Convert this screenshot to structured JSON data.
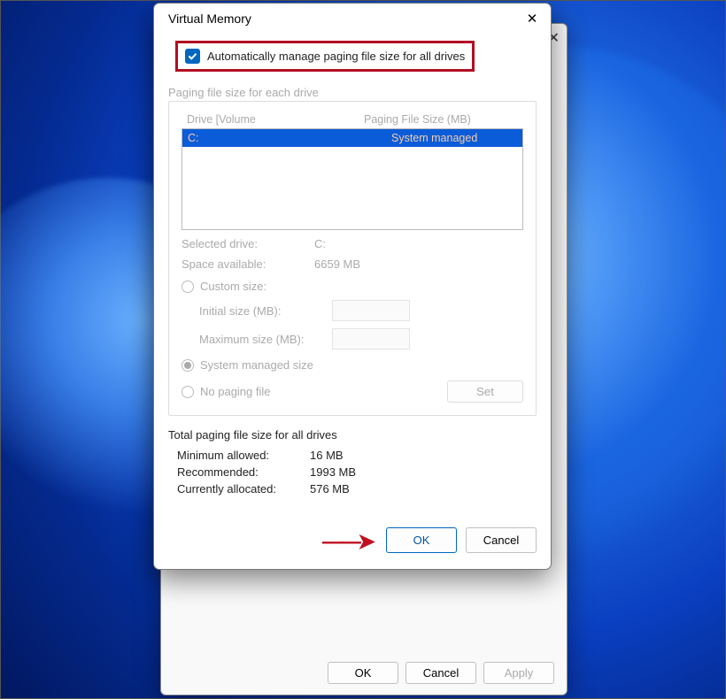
{
  "dialog": {
    "title": "Virtual Memory",
    "auto_manage_label": "Automatically manage paging file size for all drives",
    "drive_section_title": "Paging file size for each drive",
    "columns": {
      "drive": "Drive  [Volume",
      "size": "Paging File Size (MB)"
    },
    "drives": [
      {
        "name": "C:",
        "size": "System managed"
      }
    ],
    "selected_drive_label": "Selected drive:",
    "selected_drive_value": "C:",
    "space_label": "Space available:",
    "space_value": "6659 MB",
    "custom_label": "Custom size:",
    "initial_label": "Initial size (MB):",
    "max_label": "Maximum size (MB):",
    "system_managed_label": "System managed size",
    "no_paging_label": "No paging file",
    "set_label": "Set",
    "totals_title": "Total paging file size for all drives",
    "min_label": "Minimum allowed:",
    "min_value": "16 MB",
    "rec_label": "Recommended:",
    "rec_value": "1993 MB",
    "cur_label": "Currently allocated:",
    "cur_value": "576 MB",
    "ok": "OK",
    "cancel": "Cancel"
  },
  "parent": {
    "ok": "OK",
    "cancel": "Cancel",
    "apply": "Apply"
  }
}
